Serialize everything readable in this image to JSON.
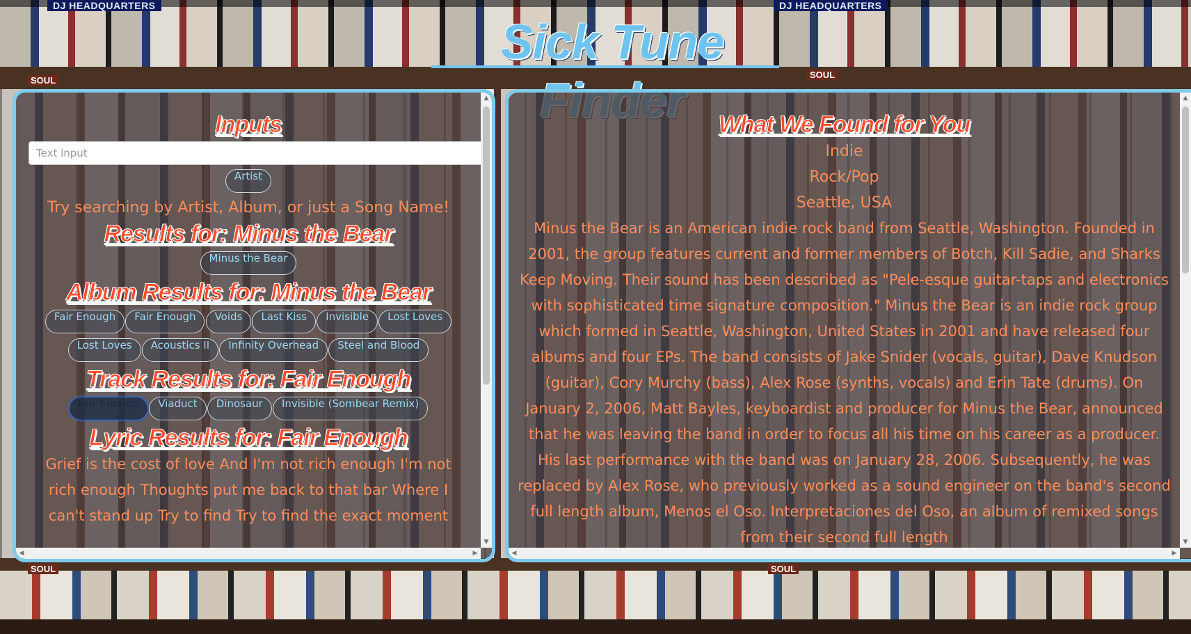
{
  "header": {
    "title": "Sick Tune Finder",
    "sign_left": "DJ HEADQUARTERS",
    "sign_right": "DJ HEADQUARTERS",
    "soul_label": "SOUL"
  },
  "inputs_panel": {
    "heading": "Inputs",
    "search": {
      "placeholder": "Text input",
      "value": ""
    },
    "mode_button": "Artist",
    "hint": "Try searching by Artist, Album, or just a Song Name!",
    "artist_results": {
      "heading": "Results for: Minus the Bear",
      "items": [
        "Minus the Bear"
      ]
    },
    "album_results": {
      "heading": "Album Results for: Minus the Bear",
      "row1": [
        "Fair Enough",
        "Fair Enough",
        "Voids",
        "Last Kiss",
        "Invisible",
        "Lost Loves"
      ],
      "row2": [
        "Lost Loves",
        "Acoustics II",
        "Infinity Overhead",
        "Steel and Blood"
      ]
    },
    "track_results": {
      "heading": "Track Results for: Fair Enough",
      "items": [
        "Fair Enough",
        "Viaduct",
        "Dinosaur",
        "Invisible (Sombear Remix)"
      ],
      "selected_index": 0
    },
    "lyric_results": {
      "heading": "Lyric Results for: Fair Enough",
      "text": "Grief is the cost of love And I'm not rich enough I'm not rich enough Thoughts put me back to that bar Where I can't stand up Try to find Try to find the exact moment"
    }
  },
  "found_panel": {
    "heading": "What We Found for You",
    "genre": "Indie",
    "style": "Rock/Pop",
    "location": "Seattle, USA",
    "bio": "Minus the Bear is an American indie rock band from Seattle, Washington. Founded in 2001, the group features current and former members of Botch, Kill Sadie, and Sharks Keep Moving. Their sound has been described as \"Pele-esque guitar-taps and electronics with sophisticated time signature composition.\" Minus the Bear is an indie rock group which formed in Seattle, Washington, United States in 2001 and have released four albums and four EPs. The band consists of Jake Snider (vocals, guitar), Dave Knudson (guitar), Cory Murchy (bass), Alex Rose (synths, vocals) and Erin Tate (drums). On January 2, 2006, Matt Bayles, keyboardist and producer for Minus the Bear, announced that he was leaving the band in order to focus all his time on his career as a producer. His last performance with the band was on January 28, 2006. Subsequently, he was replaced by Alex Rose, who previously worked as a sound engineer on the band's second full length album, Menos el Oso. Interpretaciones del Oso, an album of remixed songs from their second full length"
  },
  "colors": {
    "accent": "#7ecbea",
    "heading": "#ff4a2a",
    "body_text": "#ff8d5c",
    "pill_text": "#9ed6f0"
  }
}
